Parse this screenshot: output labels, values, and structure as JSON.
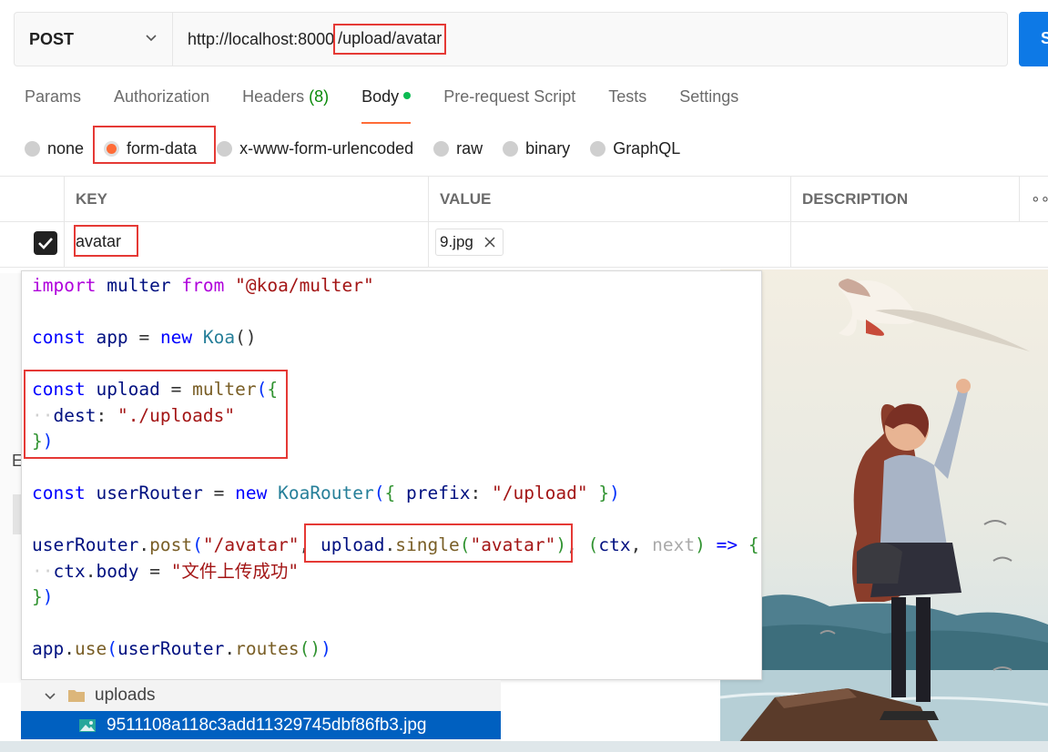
{
  "request": {
    "method": "POST",
    "url_base": "http://localhost:8000",
    "url_path": "/upload/avatar",
    "send_label": "S"
  },
  "tabs": [
    {
      "label": "Params"
    },
    {
      "label": "Authorization"
    },
    {
      "label": "Headers",
      "count": "(8)"
    },
    {
      "label": "Body"
    },
    {
      "label": "Pre-request Script"
    },
    {
      "label": "Tests"
    },
    {
      "label": "Settings"
    }
  ],
  "body_types": [
    "none",
    "form-data",
    "x-www-form-urlencoded",
    "raw",
    "binary",
    "GraphQL"
  ],
  "selected_body_type": "form-data",
  "table": {
    "headers": {
      "key": "KEY",
      "value": "VALUE",
      "description": "DESCRIPTION",
      "more": "∘∘"
    },
    "row": {
      "key": "avatar",
      "file": "9.jpg",
      "checked": true
    }
  },
  "code": {
    "l1": {
      "a": "import",
      "b": "multer",
      "c": "from",
      "d": "\"@koa/multer\""
    },
    "l2": {
      "a": "const",
      "b": "app",
      "c": "=",
      "d": "new",
      "e": "Koa",
      "f": "()"
    },
    "l3": {
      "a": "const",
      "b": "upload",
      "c": "=",
      "d": "multer",
      "e": "(",
      "f": "{"
    },
    "l4": {
      "a": "dest",
      "b": ":",
      "c": "\"./uploads\""
    },
    "l5": {
      "a": "}",
      "b": ")"
    },
    "l6": {
      "a": "const",
      "b": "userRouter",
      "c": "=",
      "d": "new",
      "e": "KoaRouter",
      "f": "(",
      "g": "{",
      "h": "prefix",
      "i": ":",
      "j": "\"/upload\"",
      "k": "}",
      "l": ")"
    },
    "l7": {
      "a": "userRouter",
      "b": ".",
      "c": "post",
      "d": "(",
      "e": "\"/avatar\"",
      "f": ",",
      "g": "upload",
      "h": ".",
      "i": "single",
      "j": "(",
      "k": "\"avatar\"",
      "l": ")",
      "m": ",",
      "n": "(",
      "o": "ctx",
      "p": ",",
      "q": "next",
      "r": ")",
      "s": "=>",
      "t": "{"
    },
    "l8": {
      "a": "ctx",
      "b": ".",
      "c": "body",
      "d": "=",
      "e": "\"文件上传成功\""
    },
    "l9": {
      "a": "}",
      "b": ")"
    },
    "l10": {
      "a": "app",
      "b": ".",
      "c": "use",
      "d": "(",
      "e": "userRouter",
      "f": ".",
      "g": "routes",
      "h": "()",
      "i": ")"
    }
  },
  "explorer": {
    "folder": "uploads",
    "file": "9511108a118c3add11329745dbf86fb3.jpg"
  },
  "fragments": {
    "left_letter": "E"
  },
  "colors": {
    "accent_orange": "#ff6c37",
    "highlight_red": "#e53935",
    "send_blue": "#0d79e6",
    "selection_blue": "#0060c0"
  }
}
